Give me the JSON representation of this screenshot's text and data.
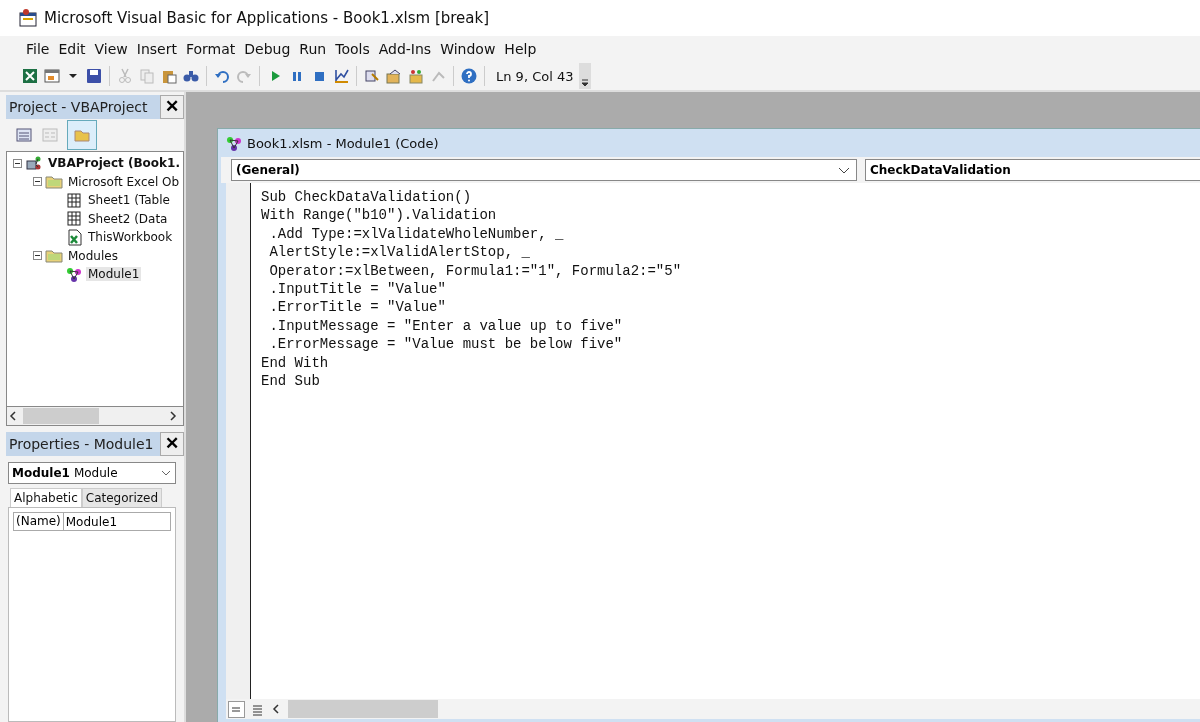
{
  "window": {
    "title": "Microsoft Visual Basic for Applications - Book1.xlsm [break]"
  },
  "menu": [
    "File",
    "Edit",
    "View",
    "Insert",
    "Format",
    "Debug",
    "Run",
    "Tools",
    "Add-Ins",
    "Window",
    "Help"
  ],
  "toolbar": {
    "position": "Ln 9, Col 43"
  },
  "project": {
    "title": "Project - VBAProject",
    "close": "✕",
    "tree": [
      {
        "label": "VBAProject (Book1.",
        "kind": "project",
        "expanded": true,
        "selected": false,
        "children": [
          {
            "label": "Microsoft Excel Ob",
            "kind": "folder",
            "expanded": true,
            "selected": false,
            "children": [
              {
                "label": "Sheet1 (Table",
                "kind": "sheet",
                "selected": false
              },
              {
                "label": "Sheet2 (Data",
                "kind": "sheet",
                "selected": false
              },
              {
                "label": "ThisWorkbook",
                "kind": "workbook",
                "selected": false
              }
            ]
          },
          {
            "label": "Modules",
            "kind": "folder",
            "expanded": true,
            "selected": false,
            "children": [
              {
                "label": "Module1",
                "kind": "module",
                "selected": true
              }
            ]
          }
        ]
      }
    ]
  },
  "properties": {
    "title": "Properties - Module1",
    "close": "✕",
    "object_name": "Module1",
    "object_type": "Module",
    "tabs": [
      {
        "label": "Alphabetic",
        "selected": true
      },
      {
        "label": "Categorized",
        "selected": false
      }
    ],
    "rows": [
      {
        "name": "(Name)",
        "value": "Module1"
      }
    ]
  },
  "code_window": {
    "title": "Book1.xlsm - Module1 (Code)",
    "object_combo": "(General)",
    "procedure_combo": "CheckDataValidation",
    "lines": [
      "Sub CheckDataValidation()",
      "With Range(\"b10\").Validation",
      " .Add Type:=xlValidateWholeNumber, _",
      " AlertStyle:=xlValidAlertStop, _",
      " Operator:=xlBetween, Formula1:=\"1\", Formula2:=\"5\"",
      " .InputTitle = \"Value\"",
      " .ErrorTitle = \"Value\"",
      " .InputMessage = \"Enter a value up to five\"",
      " .ErrorMessage = \"Value must be below five\"",
      "End With",
      "End Sub"
    ]
  }
}
